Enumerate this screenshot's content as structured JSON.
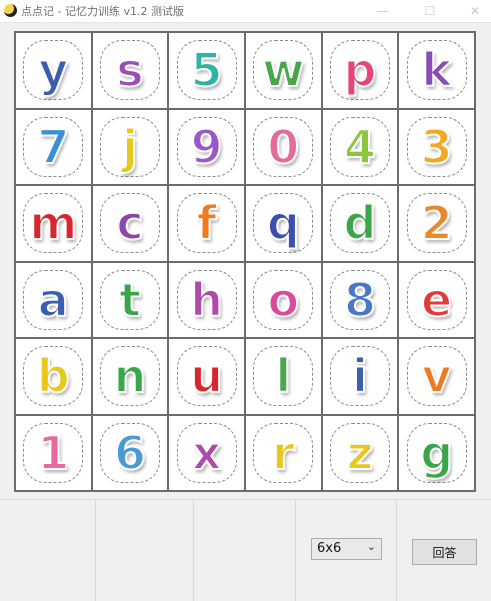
{
  "window": {
    "title": "点点记 - 记忆力训练 v1.2 测试版",
    "minimize_glyph": "—",
    "maximize_glyph": "☐",
    "close_glyph": "✕"
  },
  "grid": {
    "rows": 6,
    "cols": 6,
    "cells": [
      {
        "char": "y",
        "color": "#3b5fb0"
      },
      {
        "char": "s",
        "color": "#9b4db5"
      },
      {
        "char": "5",
        "color": "#2fb3a3"
      },
      {
        "char": "w",
        "color": "#4aa64a"
      },
      {
        "char": "p",
        "color": "#e8447a"
      },
      {
        "char": "k",
        "color": "#8a4db3"
      },
      {
        "char": "7",
        "color": "#3b8fd6"
      },
      {
        "char": "j",
        "color": "#e8c81a"
      },
      {
        "char": "9",
        "color": "#9b59c7"
      },
      {
        "char": "0",
        "color": "#e86a9a"
      },
      {
        "char": "4",
        "color": "#8cc63f"
      },
      {
        "char": "3",
        "color": "#f5a623"
      },
      {
        "char": "m",
        "color": "#d9262e"
      },
      {
        "char": "c",
        "color": "#8e44ad"
      },
      {
        "char": "f",
        "color": "#f07a1e"
      },
      {
        "char": "q",
        "color": "#3a4fb0"
      },
      {
        "char": "d",
        "color": "#3aa64a"
      },
      {
        "char": "2",
        "color": "#e8892b"
      },
      {
        "char": "a",
        "color": "#3b5fb0"
      },
      {
        "char": "t",
        "color": "#3aa64a"
      },
      {
        "char": "h",
        "color": "#b04aa8"
      },
      {
        "char": "o",
        "color": "#d94a9a"
      },
      {
        "char": "8",
        "color": "#4a78c8"
      },
      {
        "char": "e",
        "color": "#e23a3a"
      },
      {
        "char": "b",
        "color": "#e8c81a"
      },
      {
        "char": "n",
        "color": "#3aa64a"
      },
      {
        "char": "u",
        "color": "#d9262e"
      },
      {
        "char": "l",
        "color": "#4aa64a"
      },
      {
        "char": "i",
        "color": "#3b5fb0"
      },
      {
        "char": "v",
        "color": "#f07a1e"
      },
      {
        "char": "1",
        "color": "#e86a9a"
      },
      {
        "char": "6",
        "color": "#4a9ad6"
      },
      {
        "char": "x",
        "color": "#b04aa8"
      },
      {
        "char": "r",
        "color": "#e8c81a"
      },
      {
        "char": "z",
        "color": "#e8c81a"
      },
      {
        "char": "g",
        "color": "#3aa64a"
      }
    ]
  },
  "controls": {
    "size_select": {
      "value": "6x6",
      "chevron": "⌄"
    },
    "answer_button": {
      "label": "回答"
    }
  }
}
